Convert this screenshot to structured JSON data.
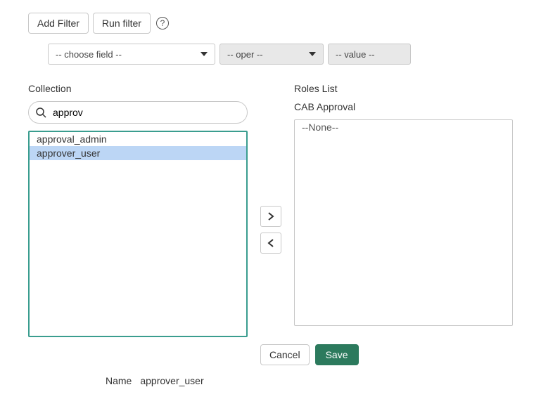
{
  "toolbar": {
    "add_filter": "Add Filter",
    "run_filter": "Run filter",
    "help_glyph": "?"
  },
  "filter": {
    "field_placeholder": "-- choose field --",
    "oper_placeholder": "-- oper --",
    "value_placeholder": "-- value --"
  },
  "collection": {
    "label": "Collection",
    "search_value": "approv",
    "items": [
      {
        "label": "approval_admin",
        "selected": false
      },
      {
        "label": "approver_user",
        "selected": true
      }
    ]
  },
  "roles": {
    "label": "Roles List",
    "subheader": "CAB Approval",
    "items": [
      {
        "label": "--None--",
        "selected": false
      }
    ]
  },
  "transfer": {
    "right_glyph": "›",
    "left_glyph": "‹"
  },
  "actions": {
    "cancel": "Cancel",
    "save": "Save"
  },
  "footer": {
    "name_label": "Name",
    "name_value": "approver_user"
  }
}
